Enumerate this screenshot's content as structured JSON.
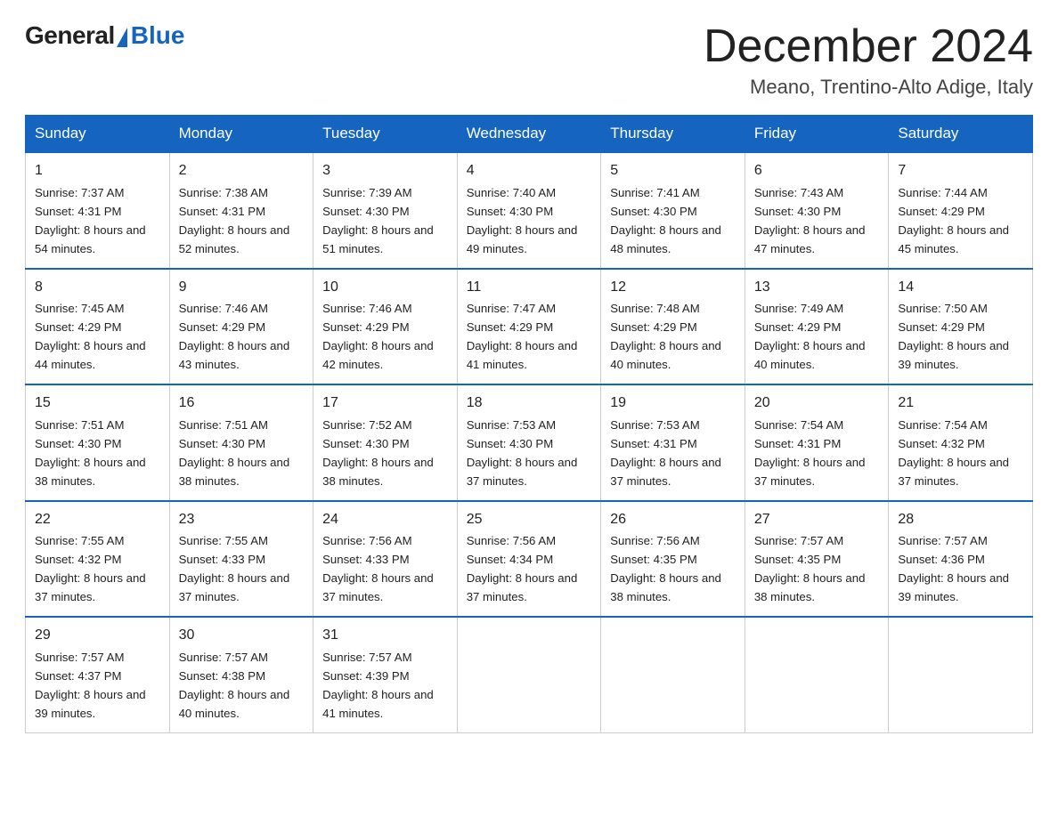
{
  "header": {
    "logo_general": "General",
    "logo_blue": "Blue",
    "month_title": "December 2024",
    "location": "Meano, Trentino-Alto Adige, Italy"
  },
  "days_of_week": [
    "Sunday",
    "Monday",
    "Tuesday",
    "Wednesday",
    "Thursday",
    "Friday",
    "Saturday"
  ],
  "weeks": [
    [
      {
        "day": "1",
        "sunrise": "7:37 AM",
        "sunset": "4:31 PM",
        "daylight": "8 hours and 54 minutes."
      },
      {
        "day": "2",
        "sunrise": "7:38 AM",
        "sunset": "4:31 PM",
        "daylight": "8 hours and 52 minutes."
      },
      {
        "day": "3",
        "sunrise": "7:39 AM",
        "sunset": "4:30 PM",
        "daylight": "8 hours and 51 minutes."
      },
      {
        "day": "4",
        "sunrise": "7:40 AM",
        "sunset": "4:30 PM",
        "daylight": "8 hours and 49 minutes."
      },
      {
        "day": "5",
        "sunrise": "7:41 AM",
        "sunset": "4:30 PM",
        "daylight": "8 hours and 48 minutes."
      },
      {
        "day": "6",
        "sunrise": "7:43 AM",
        "sunset": "4:30 PM",
        "daylight": "8 hours and 47 minutes."
      },
      {
        "day": "7",
        "sunrise": "7:44 AM",
        "sunset": "4:29 PM",
        "daylight": "8 hours and 45 minutes."
      }
    ],
    [
      {
        "day": "8",
        "sunrise": "7:45 AM",
        "sunset": "4:29 PM",
        "daylight": "8 hours and 44 minutes."
      },
      {
        "day": "9",
        "sunrise": "7:46 AM",
        "sunset": "4:29 PM",
        "daylight": "8 hours and 43 minutes."
      },
      {
        "day": "10",
        "sunrise": "7:46 AM",
        "sunset": "4:29 PM",
        "daylight": "8 hours and 42 minutes."
      },
      {
        "day": "11",
        "sunrise": "7:47 AM",
        "sunset": "4:29 PM",
        "daylight": "8 hours and 41 minutes."
      },
      {
        "day": "12",
        "sunrise": "7:48 AM",
        "sunset": "4:29 PM",
        "daylight": "8 hours and 40 minutes."
      },
      {
        "day": "13",
        "sunrise": "7:49 AM",
        "sunset": "4:29 PM",
        "daylight": "8 hours and 40 minutes."
      },
      {
        "day": "14",
        "sunrise": "7:50 AM",
        "sunset": "4:29 PM",
        "daylight": "8 hours and 39 minutes."
      }
    ],
    [
      {
        "day": "15",
        "sunrise": "7:51 AM",
        "sunset": "4:30 PM",
        "daylight": "8 hours and 38 minutes."
      },
      {
        "day": "16",
        "sunrise": "7:51 AM",
        "sunset": "4:30 PM",
        "daylight": "8 hours and 38 minutes."
      },
      {
        "day": "17",
        "sunrise": "7:52 AM",
        "sunset": "4:30 PM",
        "daylight": "8 hours and 38 minutes."
      },
      {
        "day": "18",
        "sunrise": "7:53 AM",
        "sunset": "4:30 PM",
        "daylight": "8 hours and 37 minutes."
      },
      {
        "day": "19",
        "sunrise": "7:53 AM",
        "sunset": "4:31 PM",
        "daylight": "8 hours and 37 minutes."
      },
      {
        "day": "20",
        "sunrise": "7:54 AM",
        "sunset": "4:31 PM",
        "daylight": "8 hours and 37 minutes."
      },
      {
        "day": "21",
        "sunrise": "7:54 AM",
        "sunset": "4:32 PM",
        "daylight": "8 hours and 37 minutes."
      }
    ],
    [
      {
        "day": "22",
        "sunrise": "7:55 AM",
        "sunset": "4:32 PM",
        "daylight": "8 hours and 37 minutes."
      },
      {
        "day": "23",
        "sunrise": "7:55 AM",
        "sunset": "4:33 PM",
        "daylight": "8 hours and 37 minutes."
      },
      {
        "day": "24",
        "sunrise": "7:56 AM",
        "sunset": "4:33 PM",
        "daylight": "8 hours and 37 minutes."
      },
      {
        "day": "25",
        "sunrise": "7:56 AM",
        "sunset": "4:34 PM",
        "daylight": "8 hours and 37 minutes."
      },
      {
        "day": "26",
        "sunrise": "7:56 AM",
        "sunset": "4:35 PM",
        "daylight": "8 hours and 38 minutes."
      },
      {
        "day": "27",
        "sunrise": "7:57 AM",
        "sunset": "4:35 PM",
        "daylight": "8 hours and 38 minutes."
      },
      {
        "day": "28",
        "sunrise": "7:57 AM",
        "sunset": "4:36 PM",
        "daylight": "8 hours and 39 minutes."
      }
    ],
    [
      {
        "day": "29",
        "sunrise": "7:57 AM",
        "sunset": "4:37 PM",
        "daylight": "8 hours and 39 minutes."
      },
      {
        "day": "30",
        "sunrise": "7:57 AM",
        "sunset": "4:38 PM",
        "daylight": "8 hours and 40 minutes."
      },
      {
        "day": "31",
        "sunrise": "7:57 AM",
        "sunset": "4:39 PM",
        "daylight": "8 hours and 41 minutes."
      },
      null,
      null,
      null,
      null
    ]
  ],
  "labels": {
    "sunrise_prefix": "Sunrise: ",
    "sunset_prefix": "Sunset: ",
    "daylight_prefix": "Daylight: "
  }
}
